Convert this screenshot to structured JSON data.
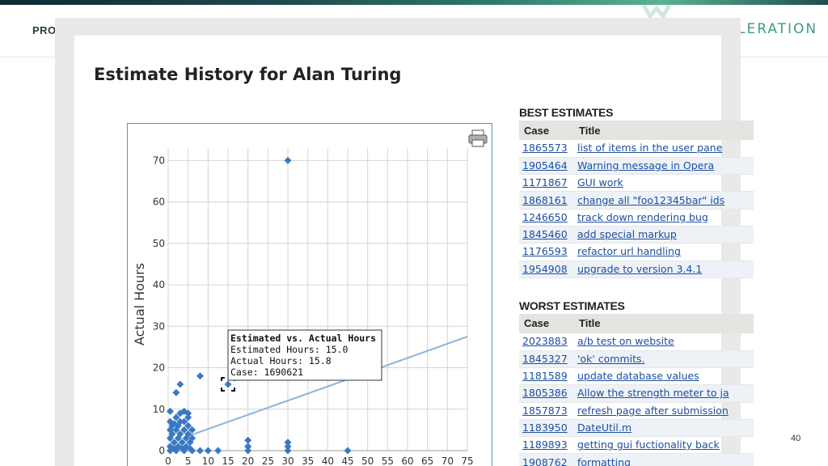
{
  "slide": {
    "left_label": "PRO",
    "right_label": "LERATION",
    "page_number": "40",
    "accent": "#3f9b8a"
  },
  "window": {
    "title": "Estimate History for Alan Turing",
    "print_icon": "printer-icon"
  },
  "chart_data": {
    "type": "scatter",
    "xlabel": "Estimated Hours",
    "ylabel": "Actual Hours",
    "xlim": [
      0,
      75
    ],
    "ylim": [
      0,
      73
    ],
    "x_ticks": [
      0,
      5,
      10,
      15,
      20,
      25,
      30,
      35,
      40,
      45,
      50,
      55,
      60,
      65,
      70,
      75
    ],
    "y_ticks": [
      0,
      10,
      20,
      30,
      40,
      50,
      60,
      70
    ],
    "grid": true,
    "marker_color": "#3a78c2",
    "line_color": "#8ab3de",
    "points": [
      {
        "x": 30,
        "y": 70
      },
      {
        "x": 8,
        "y": 18
      },
      {
        "x": 3,
        "y": 16
      },
      {
        "x": 2,
        "y": 14
      },
      {
        "x": 15,
        "y": 16
      },
      {
        "x": 0.5,
        "y": 9.5
      },
      {
        "x": 3,
        "y": 9
      },
      {
        "x": 4,
        "y": 9.5
      },
      {
        "x": 2,
        "y": 8
      },
      {
        "x": 5,
        "y": 8
      },
      {
        "x": 0.5,
        "y": 7
      },
      {
        "x": 1.5,
        "y": 6.5
      },
      {
        "x": 3,
        "y": 7
      },
      {
        "x": 5,
        "y": 6
      },
      {
        "x": 0.5,
        "y": 5
      },
      {
        "x": 1,
        "y": 4
      },
      {
        "x": 2,
        "y": 5
      },
      {
        "x": 3,
        "y": 4
      },
      {
        "x": 4,
        "y": 5
      },
      {
        "x": 5,
        "y": 4
      },
      {
        "x": 6,
        "y": 5
      },
      {
        "x": 0.5,
        "y": 3
      },
      {
        "x": 1.5,
        "y": 2
      },
      {
        "x": 2.5,
        "y": 3
      },
      {
        "x": 3.5,
        "y": 2
      },
      {
        "x": 4.5,
        "y": 3
      },
      {
        "x": 5.5,
        "y": 2
      },
      {
        "x": 6,
        "y": 3
      },
      {
        "x": 0.5,
        "y": 1
      },
      {
        "x": 1.5,
        "y": 0.5
      },
      {
        "x": 2.5,
        "y": 1
      },
      {
        "x": 3.5,
        "y": 0.5
      },
      {
        "x": 4.5,
        "y": 1
      },
      {
        "x": 5.5,
        "y": 0.5
      },
      {
        "x": 0.5,
        "y": 0
      },
      {
        "x": 2,
        "y": 0
      },
      {
        "x": 4,
        "y": 0
      },
      {
        "x": 6,
        "y": 0
      },
      {
        "x": 8,
        "y": 0
      },
      {
        "x": 10,
        "y": 0
      },
      {
        "x": 12.5,
        "y": 0
      },
      {
        "x": 20,
        "y": 2.5
      },
      {
        "x": 20,
        "y": 1
      },
      {
        "x": 20,
        "y": 0
      },
      {
        "x": 30,
        "y": 2
      },
      {
        "x": 30,
        "y": 1
      },
      {
        "x": 30,
        "y": 0
      },
      {
        "x": 45,
        "y": 0
      },
      {
        "x": 1,
        "y": 6
      },
      {
        "x": 2.5,
        "y": 6
      },
      {
        "x": 4,
        "y": 7
      },
      {
        "x": 5,
        "y": 9
      }
    ],
    "trend_line": [
      {
        "x": 5,
        "y": 3.5
      },
      {
        "x": 75,
        "y": 27.5
      }
    ],
    "selected_point": {
      "x": 15,
      "y": 16
    },
    "tooltip": {
      "title": "Estimated  vs. Actual Hours",
      "lines": [
        "Estimated Hours: 15.0",
        "Actual Hours: 15.8",
        "Case: 1690621"
      ]
    }
  },
  "best_estimates": {
    "heading": "BEST ESTIMATES",
    "columns": [
      "Case",
      "Title"
    ],
    "rows": [
      {
        "case": "1865573",
        "title": "list of items in the user pane"
      },
      {
        "case": "1905464",
        "title": "Warning message in Opera"
      },
      {
        "case": "1171867",
        "title": "GUI work"
      },
      {
        "case": "1868161",
        "title": "change all \"foo12345bar\" ids"
      },
      {
        "case": "1246650",
        "title": "track down rendering bug"
      },
      {
        "case": "1845460",
        "title": "add special markup"
      },
      {
        "case": "1176593",
        "title": "refactor url handling"
      },
      {
        "case": "1954908",
        "title": "upgrade to version 3.4.1"
      }
    ]
  },
  "worst_estimates": {
    "heading": "WORST ESTIMATES",
    "columns": [
      "Case",
      "Title"
    ],
    "rows": [
      {
        "case": "2023883",
        "title": "a/b test on website"
      },
      {
        "case": "1845327",
        "title": "'ok' commits."
      },
      {
        "case": "1181589",
        "title": "update database values"
      },
      {
        "case": "1805386",
        "title": "Allow the strength meter to ja"
      },
      {
        "case": "1857873",
        "title": "refresh page after submission"
      },
      {
        "case": "1183950",
        "title": "DateUtil.m"
      },
      {
        "case": "1189893",
        "title": "getting gui fuctionality back"
      },
      {
        "case": "1908762",
        "title": "formatting"
      }
    ]
  }
}
